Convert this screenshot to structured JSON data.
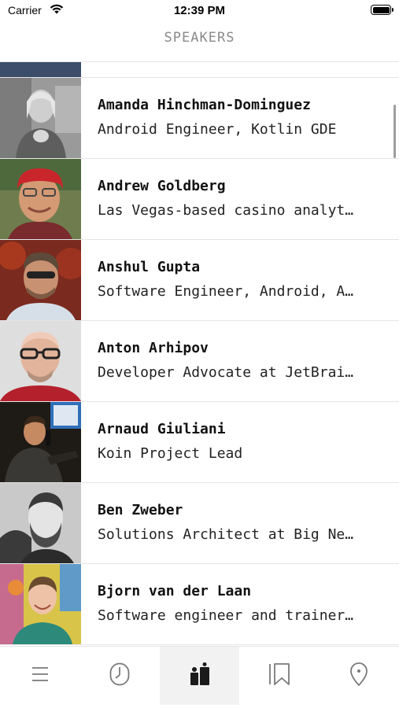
{
  "status": {
    "carrier": "Carrier",
    "time": "12:39 PM"
  },
  "nav": {
    "title": "SPEAKERS"
  },
  "speakers": [
    {
      "name": "Amanda Hinchman-Dominguez",
      "role": "Android Engineer, Kotlin GDE"
    },
    {
      "name": "Andrew Goldberg",
      "role": "Las Vegas-based casino analyt…"
    },
    {
      "name": "Anshul Gupta",
      "role": "Software Engineer, Android, A…"
    },
    {
      "name": "Anton Arhipov",
      "role": "Developer Advocate at JetBrai…"
    },
    {
      "name": "Arnaud Giuliani",
      "role": "Koin Project Lead"
    },
    {
      "name": "Ben Zweber",
      "role": "Solutions Architect at Big Ne…"
    },
    {
      "name": "Bjorn van der Laan",
      "role": "Software engineer and trainer…"
    }
  ],
  "tabs": [
    {
      "icon": "menu-icon",
      "active": false
    },
    {
      "icon": "clock-icon",
      "active": false
    },
    {
      "icon": "speakers-icon",
      "active": true
    },
    {
      "icon": "bookmark-icon",
      "active": false
    },
    {
      "icon": "location-pin-icon",
      "active": false
    }
  ]
}
